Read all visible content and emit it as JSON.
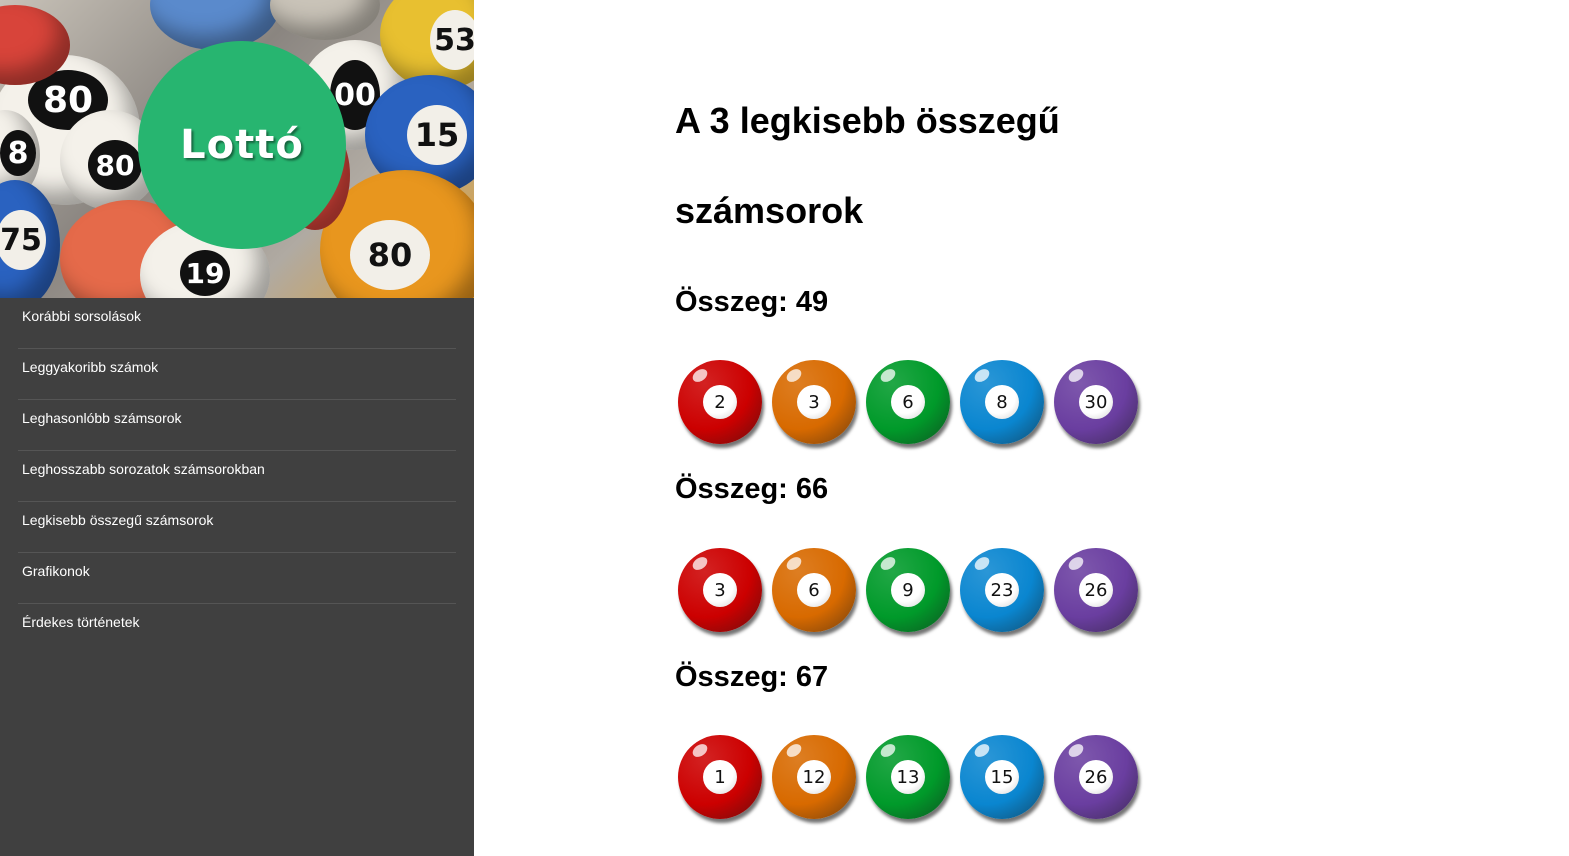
{
  "logo": {
    "text": "Lottó",
    "bg_color": "#27b570"
  },
  "header_image_numbers": [
    "80",
    "8",
    "80",
    "00",
    "75",
    "15",
    "53",
    "80",
    "19"
  ],
  "nav": [
    {
      "label": "Korábbi sorsolások"
    },
    {
      "label": "Leggyakoribb számok"
    },
    {
      "label": "Leghasonlóbb számsorok"
    },
    {
      "label": "Leghosszabb sorozatok számsorokban"
    },
    {
      "label": "Legkisebb összegű számsorok"
    },
    {
      "label": "Grafikonok"
    },
    {
      "label": "Érdekes történetek"
    }
  ],
  "main": {
    "title_line1": "A 3 legkisebb összegű",
    "title_line2": "számsorok",
    "groups": [
      {
        "label": "Összeg: 49",
        "numbers": [
          "2",
          "3",
          "6",
          "8",
          "30"
        ]
      },
      {
        "label": "Összeg: 66",
        "numbers": [
          "3",
          "6",
          "9",
          "23",
          "26"
        ]
      },
      {
        "label": "Összeg: 67",
        "numbers": [
          "1",
          "12",
          "13",
          "15",
          "26"
        ]
      }
    ]
  },
  "ball_colors": [
    "#cc0000",
    "#d86a00",
    "#009a2a",
    "#0a86d0",
    "#6a3ea0"
  ]
}
